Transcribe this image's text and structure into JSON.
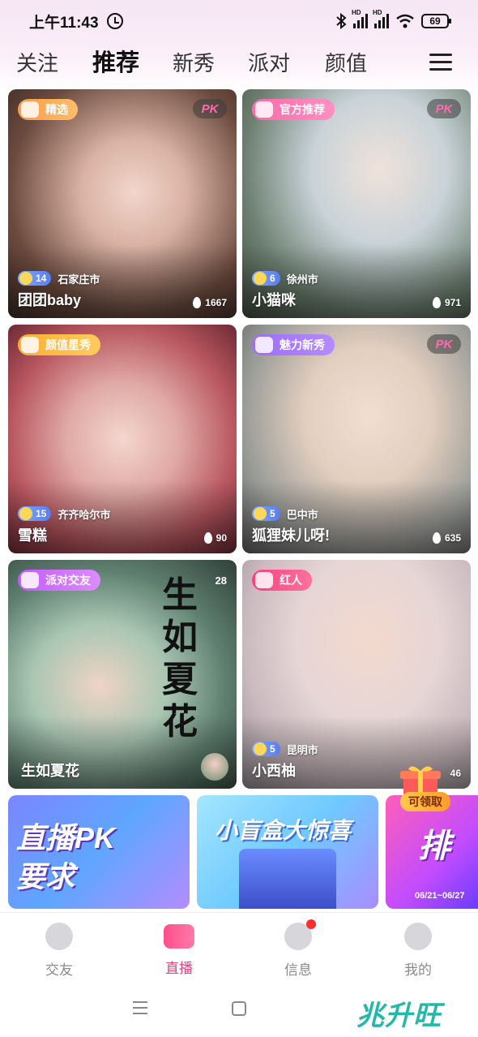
{
  "status_bar": {
    "time": "上午11:43",
    "battery": "69",
    "hd1": "HD",
    "hd2": "HD"
  },
  "tabs": [
    {
      "label": "关注",
      "active": false
    },
    {
      "label": "推荐",
      "active": true
    },
    {
      "label": "新秀",
      "active": false
    },
    {
      "label": "派对",
      "active": false
    },
    {
      "label": "颜值",
      "active": false
    }
  ],
  "cards": [
    {
      "badge": "精选",
      "badge_color": "#ff8a3d",
      "pk": "PK",
      "level": "14",
      "city": "石家庄市",
      "name": "团团baby",
      "heat": "1667"
    },
    {
      "badge": "官方推荐",
      "badge_color": "#ff5fa2",
      "pk": "PK",
      "level": "6",
      "city": "徐州市",
      "name": "小猫咪",
      "heat": "971"
    },
    {
      "badge": "颜值星秀",
      "badge_color": "#ffad2e",
      "level": "15",
      "city": "齐齐哈尔市",
      "name": "雪糕",
      "heat": "90"
    },
    {
      "badge": "魅力新秀",
      "badge_color": "#9b6bff",
      "pk": "PK",
      "level": "5",
      "city": "巴中市",
      "name": "狐狸妹儿呀!",
      "heat": "635"
    },
    {
      "badge": "派对交友",
      "badge_color": "#c054ff",
      "name": "生如夏花",
      "poster_text": "生如夏花",
      "poster_num": "28"
    },
    {
      "badge": "红人",
      "badge_color": "#ff3f7e",
      "level": "5",
      "city": "昆明市",
      "name": "小西柚",
      "heat": "46"
    }
  ],
  "banners": [
    {
      "text_line1": "直播PK",
      "text_line2": "要求"
    },
    {
      "text_line1": "小盲盒大惊喜"
    },
    {
      "text_line1": "排",
      "dates": "06/21~06/27"
    }
  ],
  "claim_button": "可领取",
  "bottom_nav": [
    {
      "label": "交友",
      "active": false
    },
    {
      "label": "直播",
      "active": true
    },
    {
      "label": "信息",
      "active": false,
      "has_dot": true
    },
    {
      "label": "我的",
      "active": false
    }
  ],
  "watermark": "兆升旺"
}
